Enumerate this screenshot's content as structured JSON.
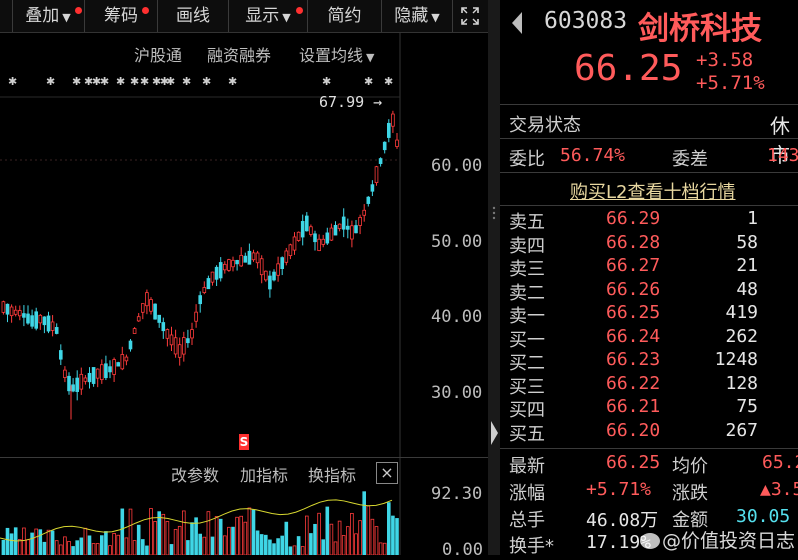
{
  "toolbar": {
    "overlay": "叠加",
    "chips": "筹码",
    "draw": "画线",
    "display": "显示",
    "simple": "简约",
    "hide": "隐藏"
  },
  "chart_links": {
    "hgt": "沪股通",
    "margin": "融资融券",
    "ma_settings": "设置均线"
  },
  "price_chart": {
    "high_label": "67.99",
    "y_ticks": [
      "60.00",
      "50.00",
      "40.00",
      "30.00"
    ],
    "s_marker": "S"
  },
  "indicator_bar": {
    "change_params": "改参数",
    "add_indicator": "加指标",
    "switch_indicator": "换指标"
  },
  "volume_chart": {
    "y_top": "92.30",
    "y_bottom": "0.00"
  },
  "quote": {
    "code": "603083",
    "name": "剑桥科技",
    "price": "66.25",
    "change": "+3.58",
    "change_pct": "+5.71%",
    "status_label": "交易状态",
    "status_value": "休市",
    "ratio_label": "委比",
    "ratio_value": "56.74%",
    "diff_label": "委差",
    "diff_value": "143",
    "l2_link": "购买L2查看十档行情"
  },
  "order_book": {
    "asks": [
      {
        "label": "卖五",
        "price": "66.29",
        "vol": "1"
      },
      {
        "label": "卖四",
        "price": "66.28",
        "vol": "58"
      },
      {
        "label": "卖三",
        "price": "66.27",
        "vol": "21"
      },
      {
        "label": "卖二",
        "price": "66.26",
        "vol": "48"
      },
      {
        "label": "卖一",
        "price": "66.25",
        "vol": "419"
      }
    ],
    "bids": [
      {
        "label": "买一",
        "price": "66.24",
        "vol": "262"
      },
      {
        "label": "买二",
        "price": "66.23",
        "vol": "1248"
      },
      {
        "label": "买三",
        "price": "66.22",
        "vol": "128"
      },
      {
        "label": "买四",
        "price": "66.21",
        "vol": "75"
      },
      {
        "label": "买五",
        "price": "66.20",
        "vol": "267"
      }
    ]
  },
  "stats": {
    "latest_label": "最新",
    "latest_value": "66.25",
    "avg_label": "均价",
    "avg_value": "65.2",
    "pct_label": "涨幅",
    "pct_value": "+5.71%",
    "chg_label": "涨跌",
    "chg_value": "▲3.5",
    "vol_label": "总手",
    "vol_value": "46.08万",
    "amt_label": "金额",
    "amt_value": "30.05",
    "turn_label": "换手*",
    "turn_value": "17.19%"
  },
  "watermark": "@价值投资日志",
  "colors": {
    "up": "#ff3b3b",
    "down": "#3fd6e6",
    "text_red": "#ff5b5b"
  }
}
